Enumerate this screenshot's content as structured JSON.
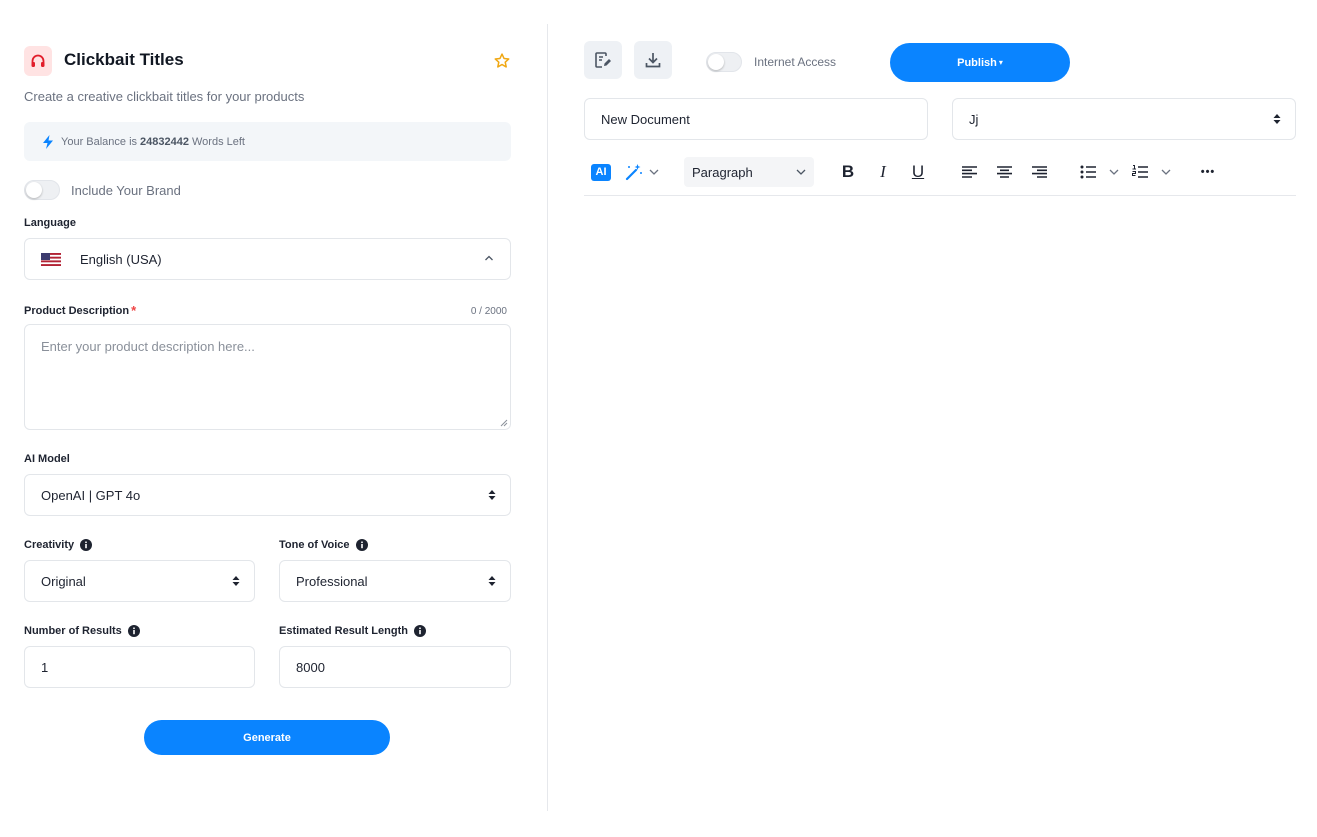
{
  "app": {
    "title": "Clickbait Titles",
    "subtitle": "Create a creative clickbait titles for your products",
    "accent_color": "#0a84ff"
  },
  "balance": {
    "prefix": "Your Balance is",
    "amount": "24832442",
    "suffix": "Words Left"
  },
  "brand_toggle": {
    "label": "Include Your Brand",
    "on": false
  },
  "language": {
    "label": "Language",
    "value": "English (USA)"
  },
  "product_description": {
    "label": "Product Description",
    "required_mark": "*",
    "counter": "0 / 2000",
    "placeholder": "Enter your product description here..."
  },
  "ai_model": {
    "label": "AI Model",
    "value": "OpenAI | GPT 4o"
  },
  "creativity": {
    "label": "Creativity",
    "value": "Original"
  },
  "tone": {
    "label": "Tone of Voice",
    "value": "Professional"
  },
  "num_results": {
    "label": "Number of Results",
    "value": "1"
  },
  "result_length": {
    "label": "Estimated Result Length",
    "value": "8000"
  },
  "generate_label": "Generate",
  "editor": {
    "internet_access_label": "Internet Access",
    "publish_label": "Publish",
    "document_name": "New Document",
    "folder_value": "Jj",
    "ai_badge": "AI",
    "paragraph_label": "Paragraph",
    "bold": "B",
    "italic": "I",
    "underline": "U",
    "more": "•••"
  }
}
